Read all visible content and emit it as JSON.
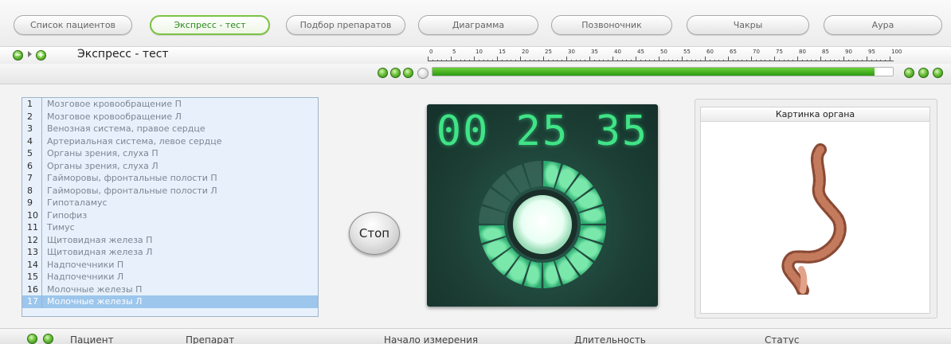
{
  "tabs": [
    {
      "label": "Список пациентов",
      "active": false
    },
    {
      "label": "Экспресс - тест",
      "active": true
    },
    {
      "label": "Подбор препаратов",
      "active": false
    },
    {
      "label": "Диаграмма",
      "active": false
    },
    {
      "label": "Позвоночник",
      "active": false
    },
    {
      "label": "Чакры",
      "active": false
    },
    {
      "label": "Аура",
      "active": false
    }
  ],
  "header": {
    "title": "Экспресс - тест",
    "collapse_icon": "minus-circle-icon",
    "add_icon": "plus-circle-icon",
    "expand_icon": "triangle-right-icon"
  },
  "progress": {
    "scale": [
      "0",
      "5",
      "10",
      "15",
      "20",
      "25",
      "30",
      "35",
      "40",
      "45",
      "50",
      "55",
      "60",
      "65",
      "70",
      "75",
      "80",
      "85",
      "90",
      "95",
      "100"
    ],
    "value_percent": 96,
    "left_indicators": 3,
    "right_indicators": 3
  },
  "list": {
    "selected_index": 17,
    "items": [
      {
        "num": "1",
        "label": "Мозговое кровообращение П"
      },
      {
        "num": "2",
        "label": "Мозговое кровообращение Л"
      },
      {
        "num": "3",
        "label": "Венозная система, правое сердце"
      },
      {
        "num": "4",
        "label": "Артериальная система, левое сердце"
      },
      {
        "num": "5",
        "label": "Органы зрения, слуха П"
      },
      {
        "num": "6",
        "label": "Органы зрения, слуха Л"
      },
      {
        "num": "7",
        "label": "Гайморовы, фронтальные полости П"
      },
      {
        "num": "8",
        "label": "Гайморовы, фронтальные полости Л"
      },
      {
        "num": "9",
        "label": "Гипоталамус"
      },
      {
        "num": "10",
        "label": "Гипофиз"
      },
      {
        "num": "11",
        "label": "Тимус"
      },
      {
        "num": "12",
        "label": "Щитовидная железа П"
      },
      {
        "num": "13",
        "label": "Щитовидная железа Л"
      },
      {
        "num": "14",
        "label": "Надпочечники П"
      },
      {
        "num": "15",
        "label": "Надпочечники Л"
      },
      {
        "num": "16",
        "label": "Молочные железы П"
      },
      {
        "num": "17",
        "label": "Молочные железы Л"
      }
    ]
  },
  "stop_button": {
    "label": "Стоп"
  },
  "timer": {
    "display": "00 25 35",
    "ring_progress": 0.75
  },
  "organ_panel": {
    "title": "Картинка органа",
    "image": "colon-organ-image"
  },
  "status_bar": {
    "columns": [
      "Пациент",
      "Препарат",
      "Начало измерения",
      "Длительность",
      "Статус"
    ]
  },
  "colors": {
    "accent": "#7cc243",
    "digits": "#3fe486",
    "selection": "#9cc6ec"
  }
}
